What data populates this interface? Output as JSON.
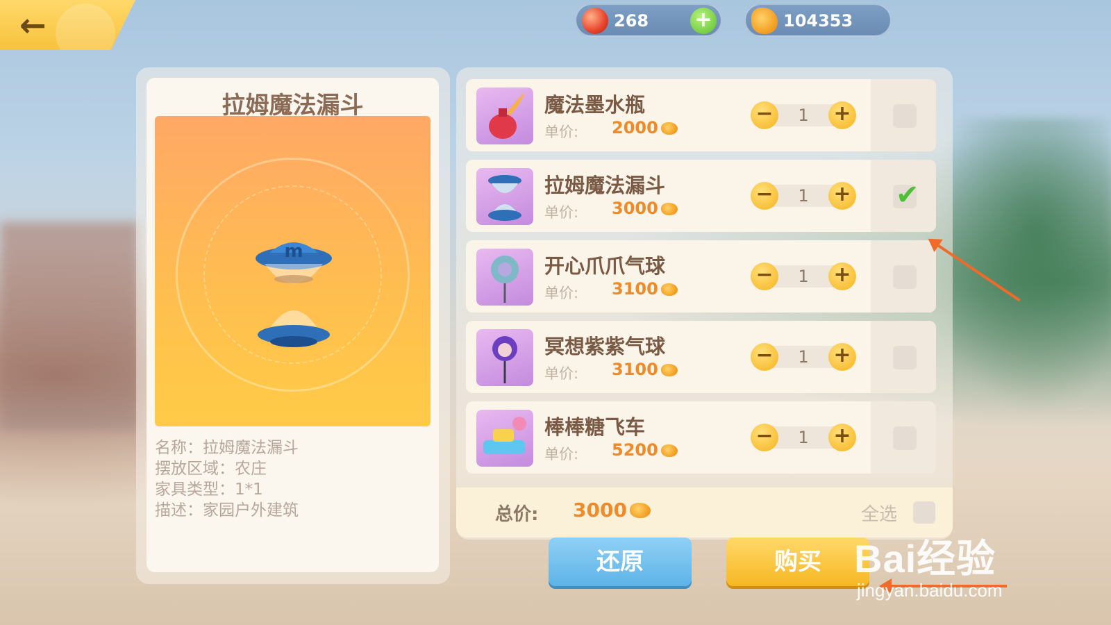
{
  "currency": {
    "gems": "268",
    "coins": "104353"
  },
  "detail": {
    "title": "拉姆魔法漏斗",
    "info": [
      "名称：拉姆魔法漏斗",
      "摆放区域：农庄",
      "家具类型：1*1",
      "描述：家园户外建筑"
    ]
  },
  "items": [
    {
      "name": "魔法墨水瓶",
      "price_label": "单价:",
      "price": "2000",
      "qty": "1",
      "checked": false,
      "icon": "ink-bottle-icon"
    },
    {
      "name": "拉姆魔法漏斗",
      "price_label": "单价:",
      "price": "3000",
      "qty": "1",
      "checked": true,
      "icon": "magic-funnel-icon"
    },
    {
      "name": "开心爪爪气球",
      "price_label": "单价:",
      "price": "3100",
      "qty": "1",
      "checked": false,
      "icon": "paw-balloon-icon"
    },
    {
      "name": "冥想紫紫气球",
      "price_label": "单价:",
      "price": "3100",
      "qty": "1",
      "checked": false,
      "icon": "purple-balloon-icon"
    },
    {
      "name": "棒棒糖飞车",
      "price_label": "单价:",
      "price": "5200",
      "qty": "1",
      "checked": false,
      "icon": "lollipop-car-icon"
    }
  ],
  "stepper": {
    "minus": "−",
    "plus": "+"
  },
  "total": {
    "label": "总价:",
    "value": "3000",
    "select_all": "全选"
  },
  "buttons": {
    "restore": "还原",
    "buy": "购买"
  },
  "watermark": {
    "main": "Bai经验",
    "sub": "jingyan.baidu.com"
  },
  "colors": {
    "accent_orange": "#ef8a28",
    "restore_blue": "#5eb3e6",
    "buy_yellow": "#f6b722",
    "annotation": "#f06a2a"
  }
}
